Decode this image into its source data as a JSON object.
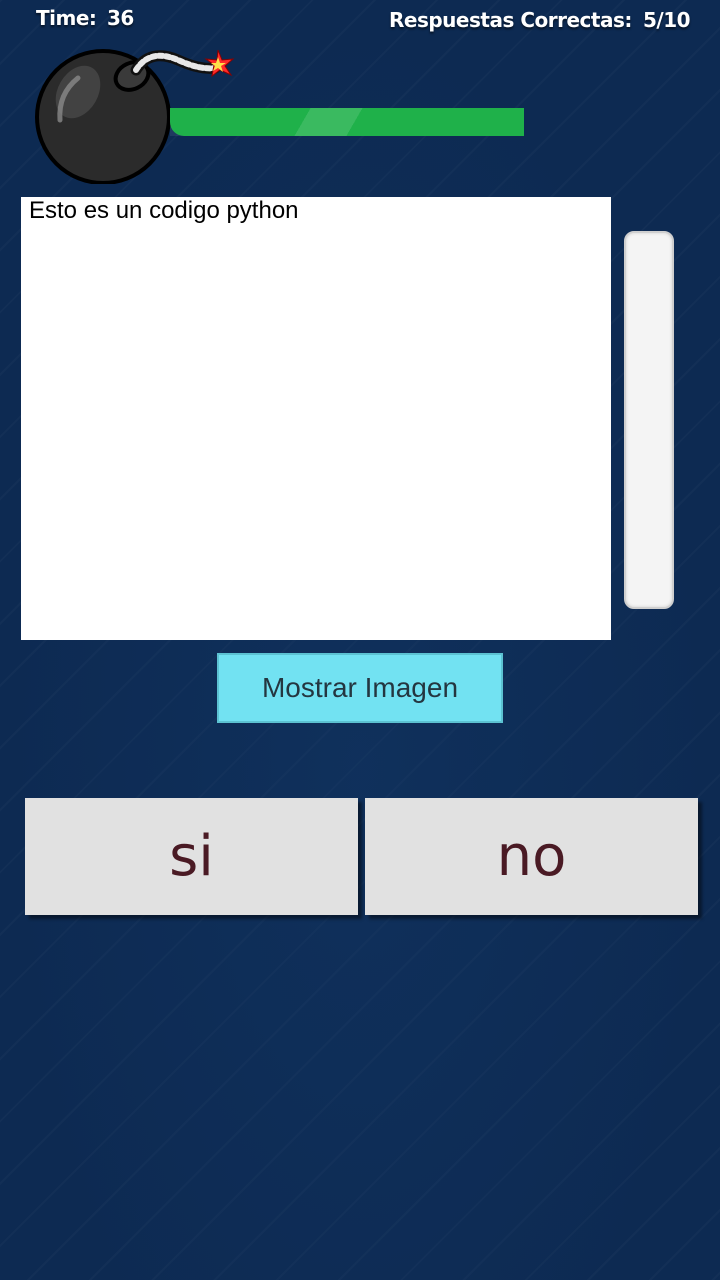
{
  "hud": {
    "time_label": "Time:",
    "time_value": "36",
    "score_label": "Respuestas Correctas:",
    "score_value": "5/10"
  },
  "timer": {
    "icon": "bomb-icon",
    "remaining_fraction": 1.0,
    "bar_color": "#1fb14a"
  },
  "question": {
    "code_text": "Esto es un codigo python"
  },
  "buttons": {
    "show_image": "Mostrar Imagen",
    "yes": "si",
    "no": "no"
  },
  "colors": {
    "background": "#0d2a52",
    "show_image_button": "#72e2f2",
    "answer_button": "#e1e1e1",
    "answer_text": "#4a1a24"
  }
}
